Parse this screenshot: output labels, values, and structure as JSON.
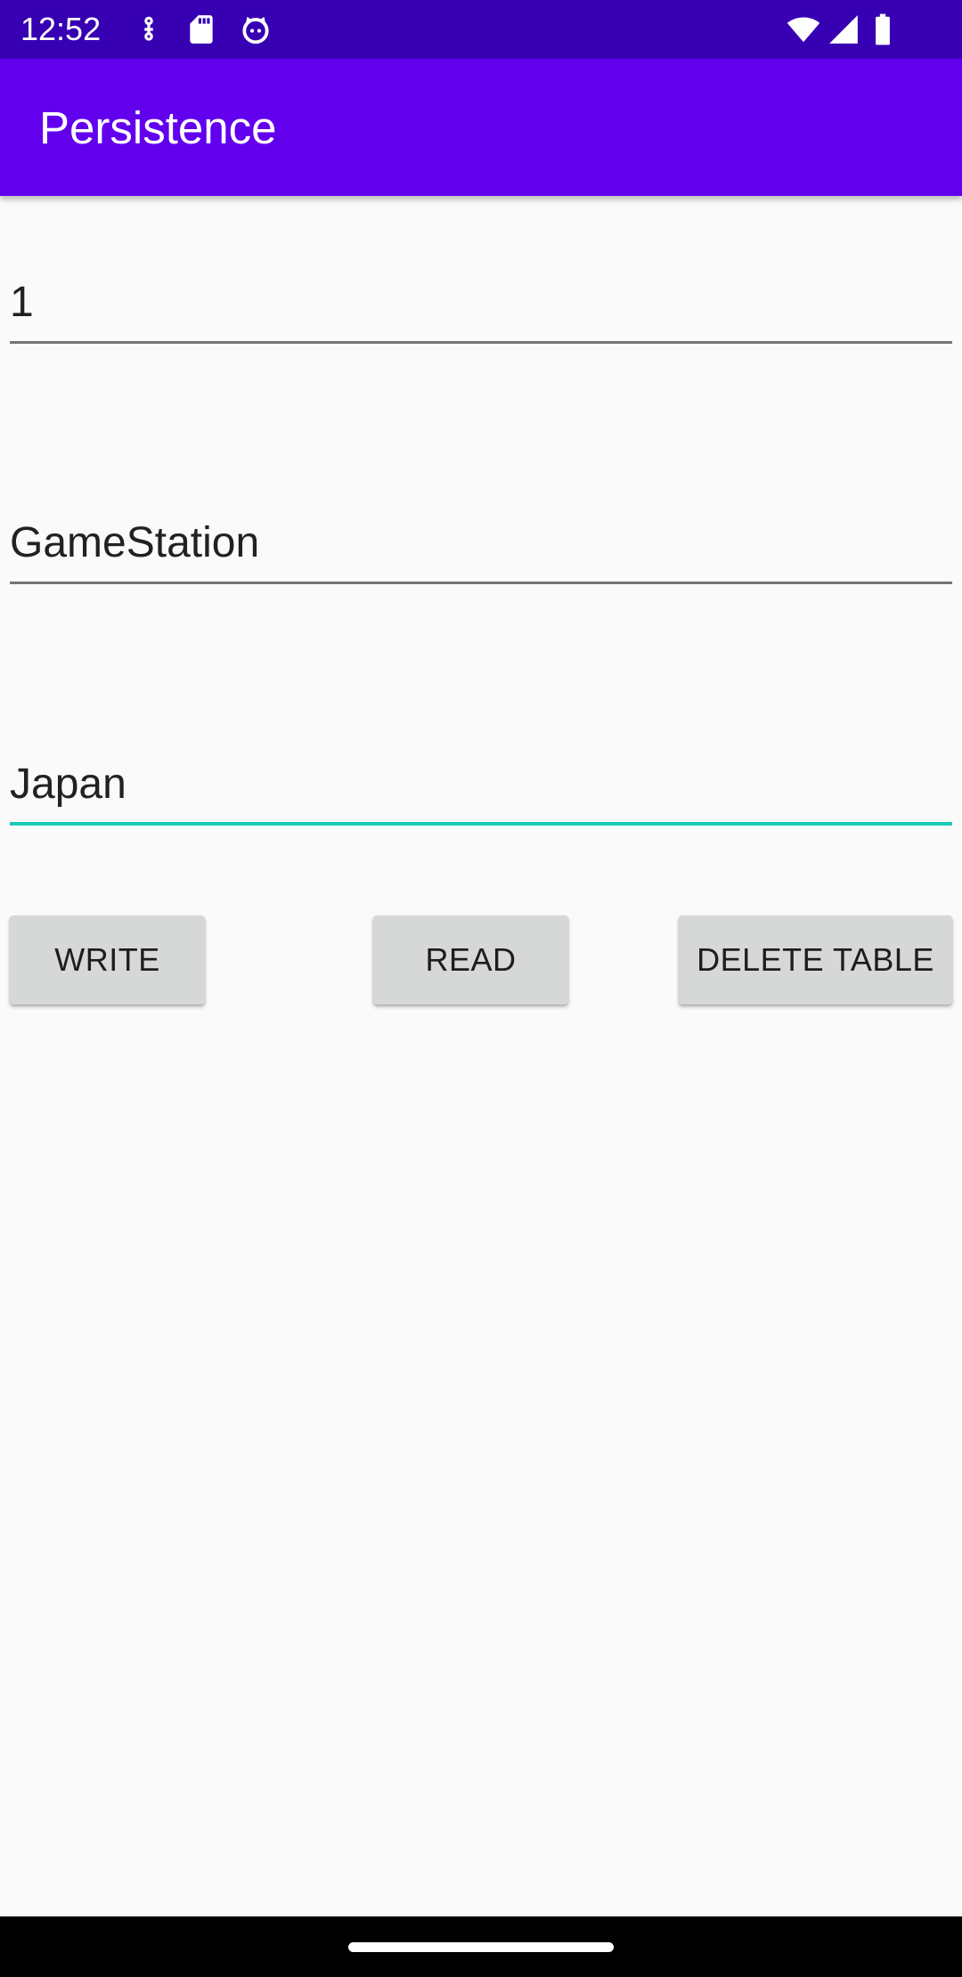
{
  "status_bar": {
    "time": "12:52",
    "icons_left": [
      "download-icon",
      "sd-card-icon",
      "debug-cat-icon"
    ],
    "icons_right": [
      "wifi-icon",
      "cell-signal-icon",
      "battery-icon"
    ]
  },
  "app_bar": {
    "title": "Persistence"
  },
  "form": {
    "fields": [
      {
        "value": "1",
        "focused": false
      },
      {
        "value": "GameStation",
        "focused": false
      },
      {
        "value": "Japan",
        "focused": true
      }
    ]
  },
  "buttons": {
    "write": "WRITE",
    "read": "READ",
    "delete_table": "DELETE TABLE"
  },
  "colors": {
    "status_bar": "#3700b3",
    "app_bar": "#6200ee",
    "accent": "#1ccbb7",
    "background": "#fafafa",
    "button": "#d6d7d7"
  }
}
